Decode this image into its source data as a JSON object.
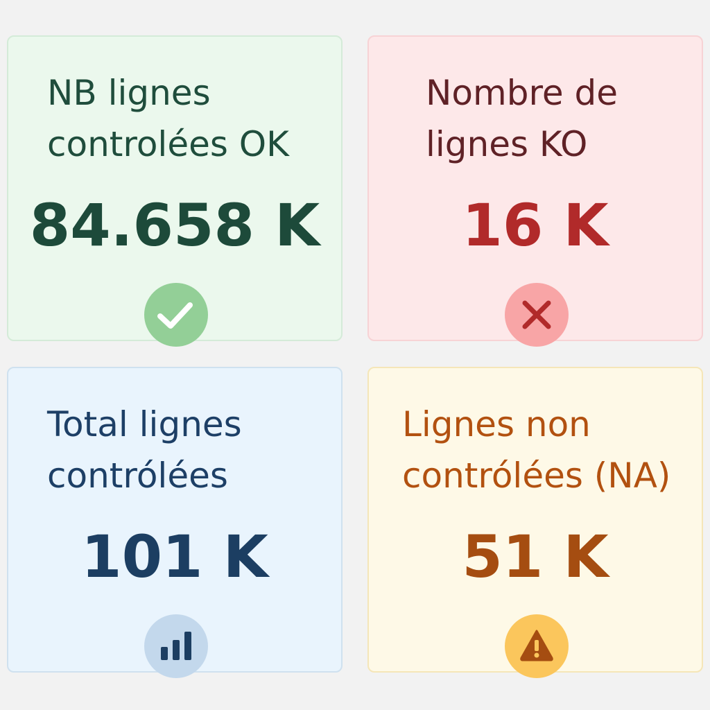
{
  "colors": {
    "ok_accent": "#93cf97",
    "ko_accent": "#b12a2a",
    "total_accent": "#1c3e62",
    "na_accent": "#a54d11"
  },
  "cards": [
    {
      "id": "ok",
      "title_lines": [
        "NB lignes",
        "controlées OK"
      ],
      "value": "84.658 K",
      "icon": "check-icon"
    },
    {
      "id": "ko",
      "title_lines": [
        "Nombre de",
        "lignes KO"
      ],
      "value": "16 K",
      "icon": "cross-icon"
    },
    {
      "id": "total",
      "title_lines": [
        "Total lignes",
        "contrólées"
      ],
      "value": "101 K",
      "icon": "bar-chart-icon"
    },
    {
      "id": "na",
      "title_lines": [
        "Lignes non",
        "contrólées (NA)"
      ],
      "value": "51 K",
      "icon": "warning-icon"
    }
  ]
}
